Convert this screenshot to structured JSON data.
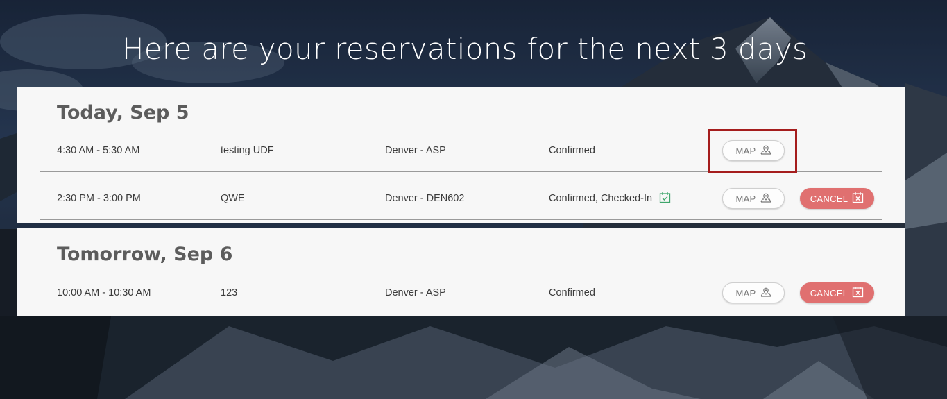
{
  "page": {
    "title": "Here are your reservations for the next 3 days"
  },
  "days": [
    {
      "heading": "Today, Sep 5",
      "reservations": [
        {
          "time": "4:30 AM - 5:30 AM",
          "name": "testing UDF",
          "location": "Denver - ASP",
          "status": "Confirmed",
          "map_label": "MAP",
          "highlighted": true
        },
        {
          "time": "2:30 PM - 3:00 PM",
          "name": "QWE",
          "location": "Denver - DEN602",
          "status": "Confirmed, Checked-In",
          "status_icon": "calendar-check-icon",
          "map_label": "MAP",
          "cancel_label": "CANCEL"
        }
      ]
    },
    {
      "heading": "Tomorrow, Sep 6",
      "reservations": [
        {
          "time": "10:00 AM - 10:30 AM",
          "name": "123",
          "location": "Denver - ASP",
          "status": "Confirmed",
          "map_label": "MAP",
          "cancel_label": "CANCEL"
        }
      ]
    }
  ],
  "colors": {
    "card_bg": "#f7f7f7",
    "heading": "#5c5c5c",
    "cancel_bg": "#e07070",
    "checkin_icon": "#3fa66b",
    "highlight_border": "#a51d1d"
  }
}
